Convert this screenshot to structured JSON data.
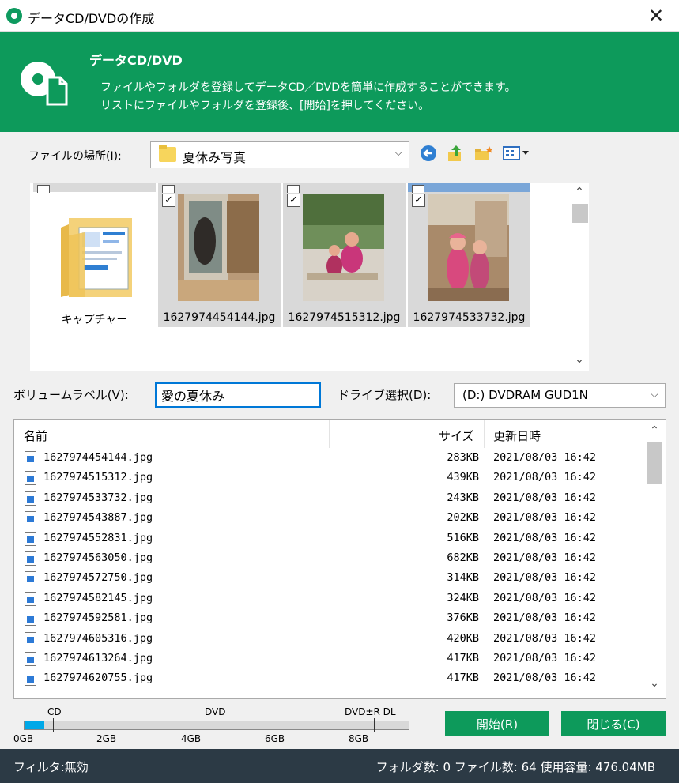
{
  "window": {
    "title": "データCD/DVDの作成",
    "close_label": "✕"
  },
  "banner": {
    "title": "データCD/DVD",
    "line1": "ファイルやフォルダを登録してデータCD／DVDを簡単に作成することができます。",
    "line2": "リストにファイルやフォルダを登録後、[開始]を押してください。"
  },
  "location": {
    "label": "ファイルの場所(I):",
    "value": "夏休み写真"
  },
  "thumbnails": [
    {
      "label": "キャプチャー",
      "kind": "folder"
    },
    {
      "label": "1627974454144.jpg",
      "kind": "image",
      "checked": true
    },
    {
      "label": "1627974515312.jpg",
      "kind": "image",
      "checked": true
    },
    {
      "label": "1627974533732.jpg",
      "kind": "image",
      "checked": true
    }
  ],
  "volume": {
    "label": "ボリュームラベル(V):",
    "value": "愛の夏休み"
  },
  "drive": {
    "label": "ドライブ選択(D):",
    "value": "(D:) DVDRAM GUD1N"
  },
  "list": {
    "headers": {
      "name": "名前",
      "size": "サイズ",
      "date": "更新日時"
    },
    "rows": [
      {
        "name": "1627974454144.jpg",
        "size": "283KB",
        "date": "2021/08/03 16:42"
      },
      {
        "name": "1627974515312.jpg",
        "size": "439KB",
        "date": "2021/08/03 16:42"
      },
      {
        "name": "1627974533732.jpg",
        "size": "243KB",
        "date": "2021/08/03 16:42"
      },
      {
        "name": "1627974543887.jpg",
        "size": "202KB",
        "date": "2021/08/03 16:42"
      },
      {
        "name": "1627974552831.jpg",
        "size": "516KB",
        "date": "2021/08/03 16:42"
      },
      {
        "name": "1627974563050.jpg",
        "size": "682KB",
        "date": "2021/08/03 16:42"
      },
      {
        "name": "1627974572750.jpg",
        "size": "314KB",
        "date": "2021/08/03 16:42"
      },
      {
        "name": "1627974582145.jpg",
        "size": "324KB",
        "date": "2021/08/03 16:42"
      },
      {
        "name": "1627974592581.jpg",
        "size": "376KB",
        "date": "2021/08/03 16:42"
      },
      {
        "name": "1627974605316.jpg",
        "size": "420KB",
        "date": "2021/08/03 16:42"
      },
      {
        "name": "1627974613264.jpg",
        "size": "417KB",
        "date": "2021/08/03 16:42"
      },
      {
        "name": "1627974620755.jpg",
        "size": "417KB",
        "date": "2021/08/03 16:42"
      }
    ]
  },
  "capacity": {
    "markers": {
      "cd": "CD",
      "dvd": "DVD",
      "dvd_dl": "DVD±R DL"
    },
    "scale": [
      "0GB",
      "2GB",
      "4GB",
      "6GB",
      "8GB"
    ],
    "used_gb": 0.476
  },
  "buttons": {
    "start": "開始(R)",
    "close": "閉じる(C)"
  },
  "status": {
    "filter": "フィルタ:無効",
    "summary": "フォルダ数: 0 ファイル数: 64 使用容量: 476.04MB"
  },
  "colors": {
    "brand_green": "#0d9a5b",
    "status_bar": "#2c3a45",
    "capacity_fill": "#00a8e8"
  }
}
